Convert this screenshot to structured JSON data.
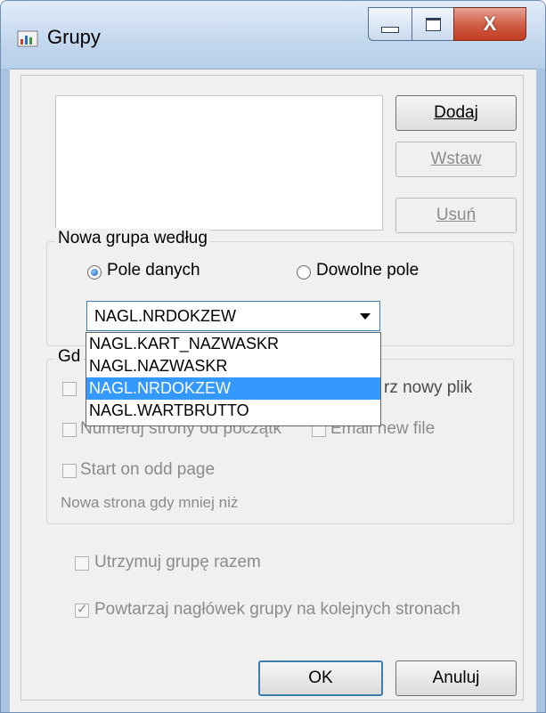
{
  "window": {
    "title": "Grupy",
    "close_glyph": "X"
  },
  "buttons": {
    "add": "Dodaj",
    "insert": "Wstaw",
    "remove": "Usuń",
    "ok": "OK",
    "cancel": "Anuluj"
  },
  "new_group": {
    "legend": "Nowa grupa według",
    "radio_field": {
      "label": "Pole danych",
      "selected": true
    },
    "radio_any": {
      "label": "Dowolne pole",
      "selected": false
    },
    "combo_value": "NAGL.NRDOKZEW",
    "options": [
      "NAGL.KART_NAZWASKR",
      "NAGL.NAZWASKR",
      "NAGL.NRDOKZEW",
      "NAGL.WARTBRUTTO"
    ],
    "selected_option": "NAGL.NRDOKZEW"
  },
  "when_group": {
    "legend": "Gd",
    "new_file_label": "rz nowy plik",
    "number_pages_label": "Numeruj strony od początk",
    "email_label": "Email new file",
    "odd_page_label": "Start on odd page",
    "new_page_label": "Nowa strona gdy mniej niż"
  },
  "options": {
    "keep_together": {
      "label": "Utrzymuj grupę razem",
      "checked": false
    },
    "repeat_header": {
      "label": "Powtarzaj nagłówek grupy na kolejnych stronach",
      "checked": true
    }
  },
  "icons": {
    "app": "app-icon",
    "minimize": "minimize-icon",
    "maximize": "maximize-icon",
    "close": "close-icon",
    "dropdown": "chevron-down-icon"
  },
  "colors": {
    "selection": "#3399ff",
    "close_button": "#c03d22",
    "titlebar": "#c3d7ee"
  }
}
